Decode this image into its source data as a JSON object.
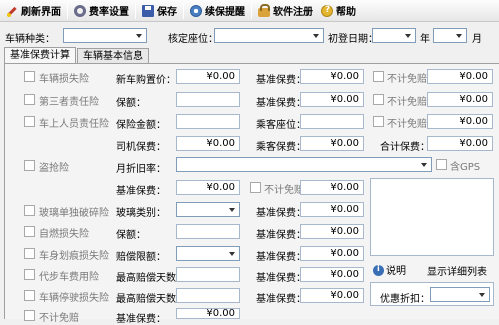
{
  "toolbar": {
    "refresh": "刷新界面",
    "rate_settings": "费率设置",
    "save": "保存",
    "renewal_remind": "续保提醒",
    "software_register": "软件注册",
    "help": "帮助"
  },
  "filter": {
    "vehicle_type_label": "车辆种类：",
    "seat_label": "核定座位：",
    "first_register_label": "初登日期：",
    "year_unit": "年",
    "month_unit": "月"
  },
  "tabs": [
    "基准保费计算",
    "车辆基本信息"
  ],
  "form": {
    "insurance_items": [
      "车辆损失险",
      "第三者责任险",
      "车上人员责任险",
      "盗抢险",
      "玻璃单独破碎险",
      "自燃损失险",
      "车身划痕损失险",
      "代步车费用险",
      "车辆停驶损失险",
      "不计免赔"
    ],
    "labels": {
      "new_car_price": "新车购置价：",
      "base_premium": "基准保费：",
      "no_deductible": "不计免赔",
      "coverage": "保额：",
      "insured_amount": "保险金额：",
      "passenger_seats": "乘客座位：",
      "driver_premium": "司机保费：",
      "passenger_premium": "乘客保费：",
      "total_premium": "合计保费：",
      "monthly_depreciation": "月折旧率：",
      "include_gps": "含GPS",
      "glass_type": "玻璃类别：",
      "compensation_limit": "赔偿限额：",
      "max_compensation_days": "最高赔偿天数：",
      "explain": "说明",
      "show_detail_list": "显示详细列表",
      "discount": "优惠折扣："
    },
    "money_default": "¥0.00"
  }
}
